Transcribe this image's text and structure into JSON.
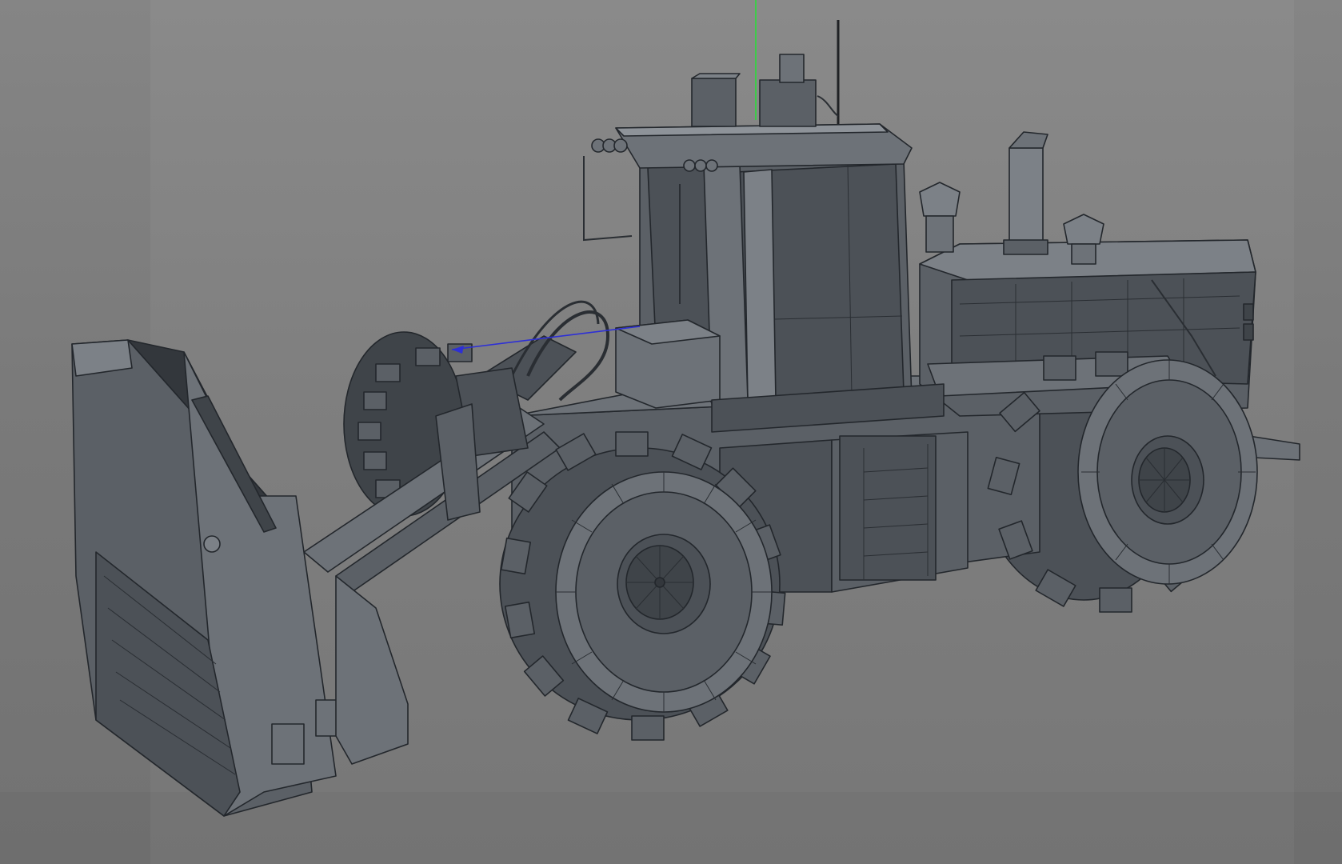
{
  "viewport": {
    "background": "#7f7f7f",
    "model_color": "#5b6066",
    "wire_color": "#23272c",
    "axis_colors": {
      "y": "#2bdc3a",
      "z": "#2d2fd6"
    }
  }
}
